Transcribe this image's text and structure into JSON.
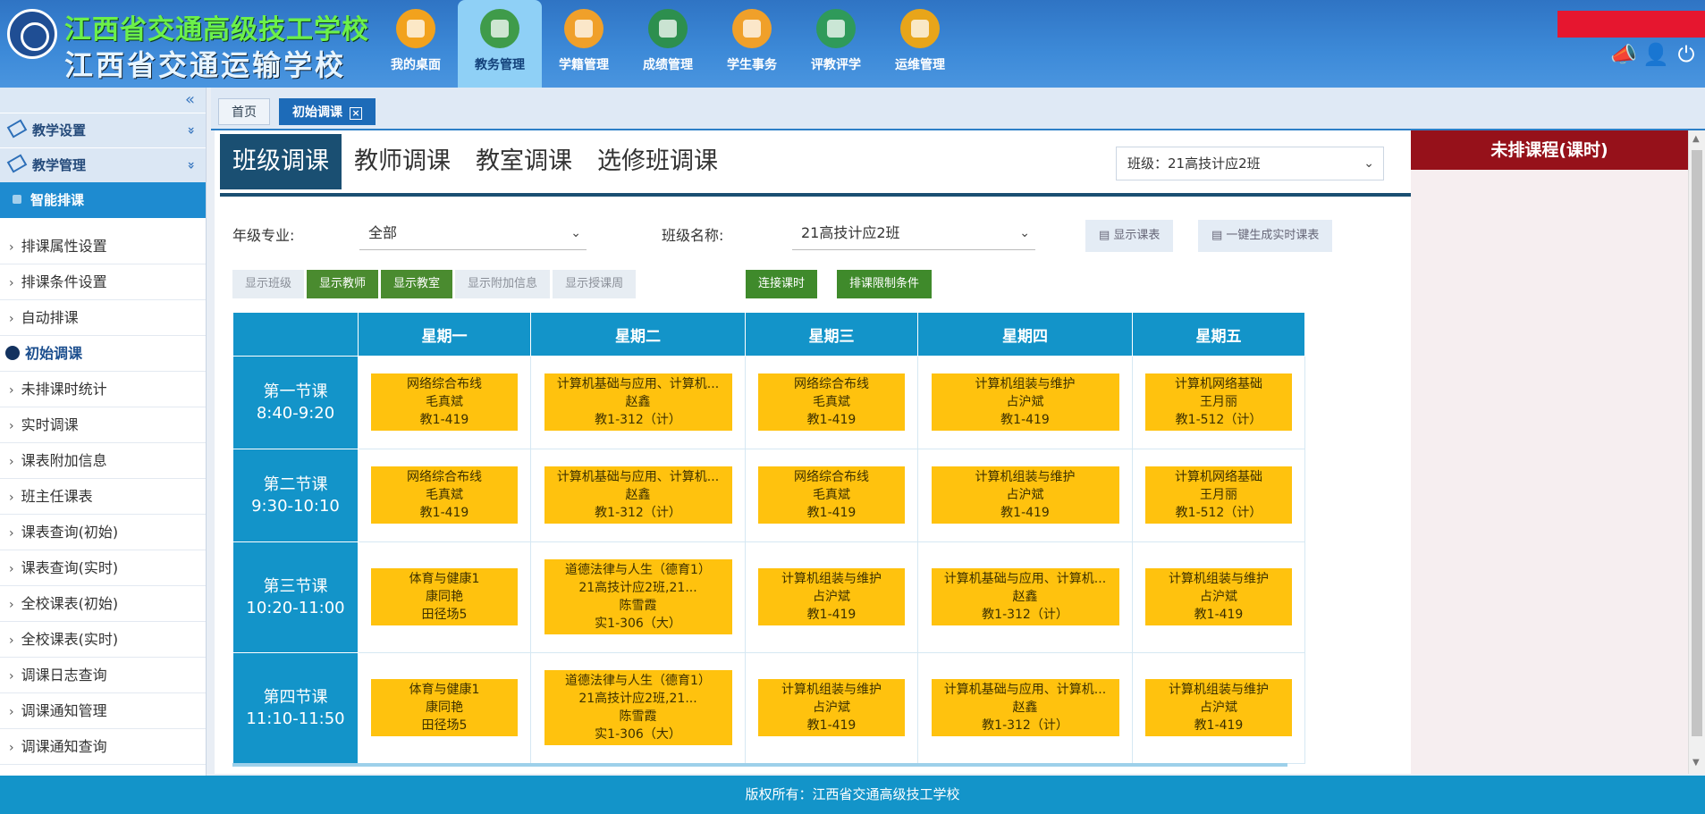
{
  "header": {
    "school_line1": "江西省交通高级技工学校",
    "school_line2": "江西省交通运输学校",
    "nav": [
      {
        "label": "我的桌面",
        "icon": "desktop-grid-icon",
        "color": "#f2a21d"
      },
      {
        "label": "教务管理",
        "icon": "academic-admin-icon",
        "color": "#3f9b4a"
      },
      {
        "label": "学籍管理",
        "icon": "student-record-icon",
        "color": "#f0a02a"
      },
      {
        "label": "成绩管理",
        "icon": "grades-icon",
        "color": "#2d8f4e"
      },
      {
        "label": "学生事务",
        "icon": "student-affairs-icon",
        "color": "#f0a02a"
      },
      {
        "label": "评教评学",
        "icon": "evaluation-icon",
        "color": "#2f9a5a"
      },
      {
        "label": "运维管理",
        "icon": "ops-icon",
        "color": "#e8a51a"
      }
    ],
    "active_nav": "教务管理"
  },
  "tabs": [
    {
      "label": "首页"
    },
    {
      "label": "初始调课",
      "close": "×"
    }
  ],
  "sidebar": {
    "collapse_glyph": "«",
    "groups": [
      {
        "label": "教学设置",
        "chev": "»"
      },
      {
        "label": "教学管理",
        "chev": "»"
      }
    ],
    "smart": "智能排课",
    "items": [
      {
        "label": "排课属性设置"
      },
      {
        "label": "排课条件设置"
      },
      {
        "label": "自动排课"
      },
      {
        "label": "初始调课",
        "active": true
      },
      {
        "label": "未排课时统计"
      },
      {
        "label": "实时调课"
      },
      {
        "label": "课表附加信息"
      },
      {
        "label": "班主任课表"
      },
      {
        "label": "课表查询(初始)"
      },
      {
        "label": "课表查询(实时)"
      },
      {
        "label": "全校课表(初始)"
      },
      {
        "label": "全校课表(实时)"
      },
      {
        "label": "调课日志查询"
      },
      {
        "label": "调课通知管理"
      },
      {
        "label": "调课通知查询"
      }
    ]
  },
  "main": {
    "subtabs": [
      "班级调课",
      "教师调课",
      "教室调课",
      "选修班调课"
    ],
    "active_subtab": "班级调课",
    "class_select": "班级：21高技计应2班",
    "grade_label": "年级专业:",
    "grade_value": "全部",
    "classname_label": "班级名称:",
    "classname_value": "21高技计应2班",
    "btn_show_table": "显示课表",
    "btn_gen_table": "一键生成实时课表",
    "toggles": [
      {
        "label": "显示班级",
        "on": false
      },
      {
        "label": "显示教师",
        "on": true
      },
      {
        "label": "显示教室",
        "on": true
      },
      {
        "label": "显示附加信息",
        "on": false
      },
      {
        "label": "显示授课周",
        "on": false
      }
    ],
    "btn_continuous": "连接课时",
    "btn_constraints": "排课限制条件",
    "days": [
      "星期一",
      "星期二",
      "星期三",
      "星期四",
      "星期五"
    ],
    "periods": [
      {
        "name": "第一节课",
        "time": "8:40-9:20"
      },
      {
        "name": "第二节课",
        "time": "9:30-10:10"
      },
      {
        "name": "第三节课",
        "time": "10:20-11:00"
      },
      {
        "name": "第四节课",
        "time": "11:10-11:50"
      }
    ],
    "schedule": [
      [
        [
          "网络综合布线",
          "毛真斌",
          "教1-419"
        ],
        [
          "计算机基础与应用、计算机...",
          "赵鑫",
          "教1-312（计）"
        ],
        [
          "网络综合布线",
          "毛真斌",
          "教1-419"
        ],
        [
          "计算机组装与维护",
          "占沪斌",
          "教1-419"
        ],
        [
          "计算机网络基础",
          "王月丽",
          "教1-512（计）"
        ]
      ],
      [
        [
          "网络综合布线",
          "毛真斌",
          "教1-419"
        ],
        [
          "计算机基础与应用、计算机...",
          "赵鑫",
          "教1-312（计）"
        ],
        [
          "网络综合布线",
          "毛真斌",
          "教1-419"
        ],
        [
          "计算机组装与维护",
          "占沪斌",
          "教1-419"
        ],
        [
          "计算机网络基础",
          "王月丽",
          "教1-512（计）"
        ]
      ],
      [
        [
          "体育与健康1",
          "康同艳",
          "田径场5"
        ],
        [
          "道德法律与人生（德育1）",
          "21高技计应2班,21...",
          "陈雪霞",
          "实1-306（大）"
        ],
        [
          "计算机组装与维护",
          "占沪斌",
          "教1-419"
        ],
        [
          "计算机基础与应用、计算机...",
          "赵鑫",
          "教1-312（计）"
        ],
        [
          "计算机组装与维护",
          "占沪斌",
          "教1-419"
        ]
      ],
      [
        [
          "体育与健康1",
          "康同艳",
          "田径场5"
        ],
        [
          "道德法律与人生（德育1）",
          "21高技计应2班,21...",
          "陈雪霞",
          "实1-306（大）"
        ],
        [
          "计算机组装与维护",
          "占沪斌",
          "教1-419"
        ],
        [
          "计算机基础与应用、计算机...",
          "赵鑫",
          "教1-312（计）"
        ],
        [
          "计算机组装与维护",
          "占沪斌",
          "教1-419"
        ]
      ]
    ]
  },
  "right_panel": {
    "title": "未排课程(课时)"
  },
  "footer": {
    "text": "版权所有：江西省交通高级技工学校"
  },
  "colors": {
    "primary": "#1394c9",
    "course": "#ffc20e",
    "toggle_on": "#4a8b2f",
    "unscheduled_header": "#96111a"
  }
}
